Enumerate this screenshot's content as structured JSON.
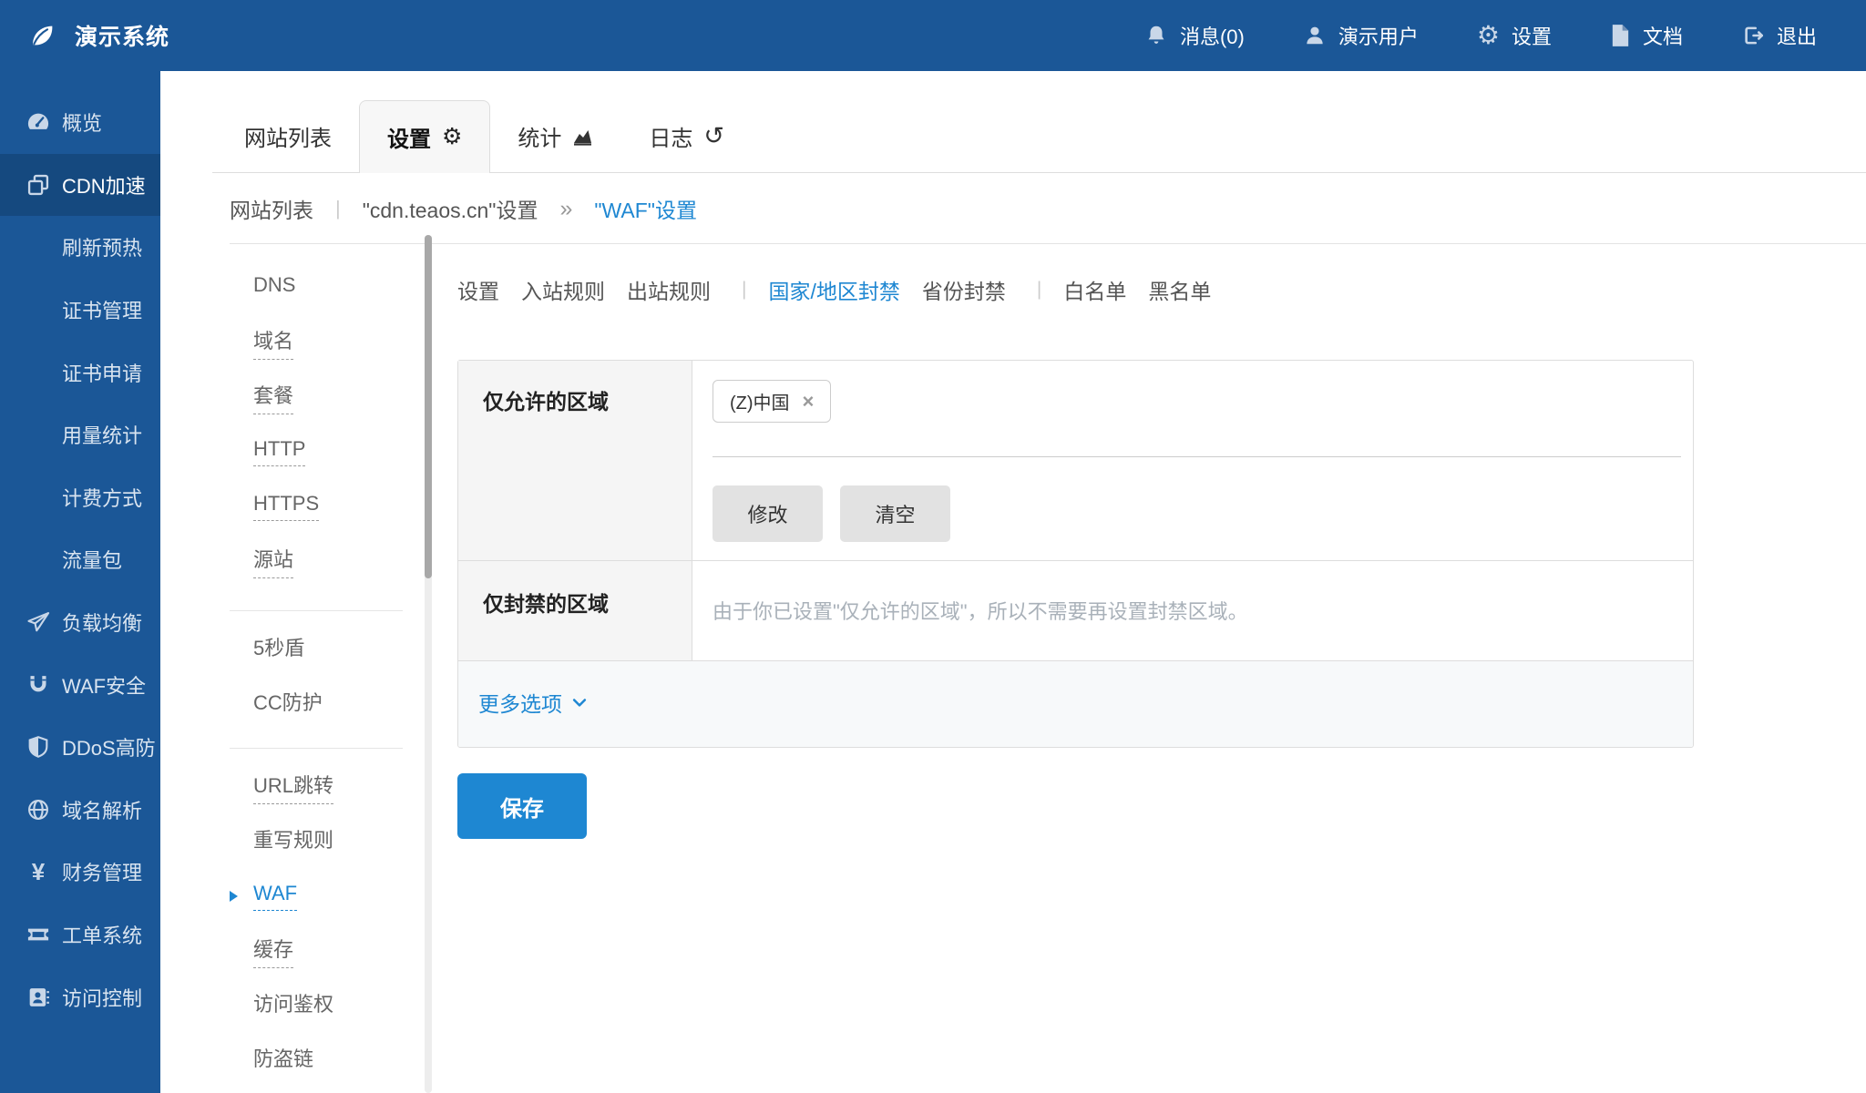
{
  "colors": {
    "topbar_bg": "#1b5797",
    "sidebar_active_bg": "#15497f",
    "accent_blue": "#1e87d2",
    "tab_active_bg": "#f7f7f7",
    "label_cell_bg": "#f5f5f5",
    "footer_bg": "#f7f9fa",
    "gray_button_bg": "#e2e2e2",
    "save_button_bg": "#1e87d2",
    "border": "#dddddd"
  },
  "glyphs": {
    "gear": "⚙",
    "history": "↺",
    "close": "×",
    "double_angle": "»",
    "pipe": "|",
    "yen": "¥"
  },
  "topbar": {
    "brand": "演示系统",
    "items": [
      {
        "label": "消息(0)",
        "icon": "bell-icon"
      },
      {
        "label": "演示用户",
        "icon": "user-icon"
      },
      {
        "label": "设置",
        "icon": "gear-icon"
      },
      {
        "label": "文档",
        "icon": "document-icon"
      },
      {
        "label": "退出",
        "icon": "logout-icon"
      }
    ]
  },
  "sidebar": {
    "items": [
      {
        "label": "概览",
        "icon": "dashboard-icon"
      },
      {
        "label": "CDN加速",
        "icon": "cdn-icon",
        "active": true
      },
      {
        "label": "刷新预热"
      },
      {
        "label": "证书管理"
      },
      {
        "label": "证书申请"
      },
      {
        "label": "用量统计"
      },
      {
        "label": "计费方式"
      },
      {
        "label": "流量包"
      },
      {
        "label": "负载均衡",
        "icon": "load-balancer-icon"
      },
      {
        "label": "WAF安全",
        "icon": "magnet-icon"
      },
      {
        "label": "DDoS高防",
        "icon": "shield-icon"
      },
      {
        "label": "域名解析",
        "icon": "globe-icon"
      },
      {
        "label": "财务管理",
        "icon": "finance-icon"
      },
      {
        "label": "工单系统",
        "icon": "ticket-icon"
      },
      {
        "label": "访问控制",
        "icon": "access-icon"
      }
    ]
  },
  "site_tabs": [
    {
      "label": "网站列表"
    },
    {
      "label": "设置",
      "active": true
    },
    {
      "label": "统计"
    },
    {
      "label": "日志"
    }
  ],
  "breadcrumb": {
    "items": [
      "网站列表",
      "\"cdn.teaos.cn\"设置",
      "\"WAF\"设置"
    ]
  },
  "subnav": {
    "items": [
      {
        "label": "DNS"
      },
      {
        "label": "域名",
        "dashed": true
      },
      {
        "label": "套餐",
        "dashed": true
      },
      {
        "label": "HTTP",
        "dashed": true
      },
      {
        "label": "HTTPS",
        "dashed": true
      },
      {
        "label": "源站",
        "dashed": true
      },
      {
        "label": "5秒盾"
      },
      {
        "label": "CC防护"
      },
      {
        "label": "URL跳转",
        "dashed": true
      },
      {
        "label": "重写规则"
      },
      {
        "label": "WAF",
        "dashed": true,
        "active": true
      },
      {
        "label": "缓存",
        "dashed": true
      },
      {
        "label": "访问鉴权"
      },
      {
        "label": "防盗链"
      }
    ]
  },
  "waf_tabs": {
    "items": [
      {
        "label": "设置"
      },
      {
        "label": "入站规则"
      },
      {
        "label": "出站规则"
      },
      {
        "label": "国家/地区封禁",
        "active": true
      },
      {
        "label": "省份封禁"
      },
      {
        "label": "白名单"
      },
      {
        "label": "黑名单"
      }
    ]
  },
  "form": {
    "allowed_label": "仅允许的区域",
    "allowed_tag": "(Z)中国",
    "modify_button": "修改",
    "clear_button": "清空",
    "blocked_label": "仅封禁的区域",
    "blocked_placeholder": "由于你已设置\"仅允许的区域\"，所以不需要再设置封禁区域。",
    "more_options": "更多选项",
    "save_button": "保存"
  }
}
